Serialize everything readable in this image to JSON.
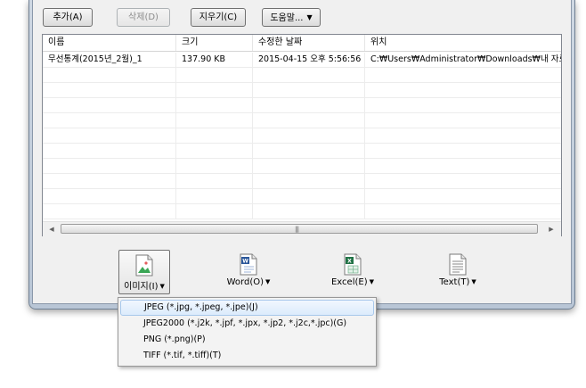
{
  "toolbar": {
    "add_label": "추가(A)",
    "delete_label": "삭제(D)",
    "clear_label": "지우기(C)",
    "help_label": "도움말..."
  },
  "list": {
    "columns": [
      "이름",
      "크기",
      "수정한 날짜",
      "위치"
    ],
    "rows": [
      [
        "무선통계(2015년_2월)_1",
        "137.90 KB",
        "2015-04-15 오후 5:56:56",
        "C:₩Users₩Administrator₩Downloads₩내 자료"
      ]
    ]
  },
  "export": {
    "image_label": "이미지(I)",
    "word_label": "Word(O)",
    "excel_label": "Excel(E)",
    "text_label": "Text(T)"
  },
  "menu": {
    "items": [
      "JPEG (*.jpg, *.jpeg, *.jpe)(J)",
      "JPEG2000 (*.j2k, *.jpf, *.jpx, *.jp2, *.j2c,*.jpc)(G)",
      "PNG (*.png)(P)",
      "TIFF (*.tif, *.tiff)(T)"
    ]
  },
  "colors": {
    "word_blue": "#2b579a",
    "excel_green": "#217346",
    "image_green": "#3aa655",
    "menu_highlight": "#dcebfc"
  }
}
